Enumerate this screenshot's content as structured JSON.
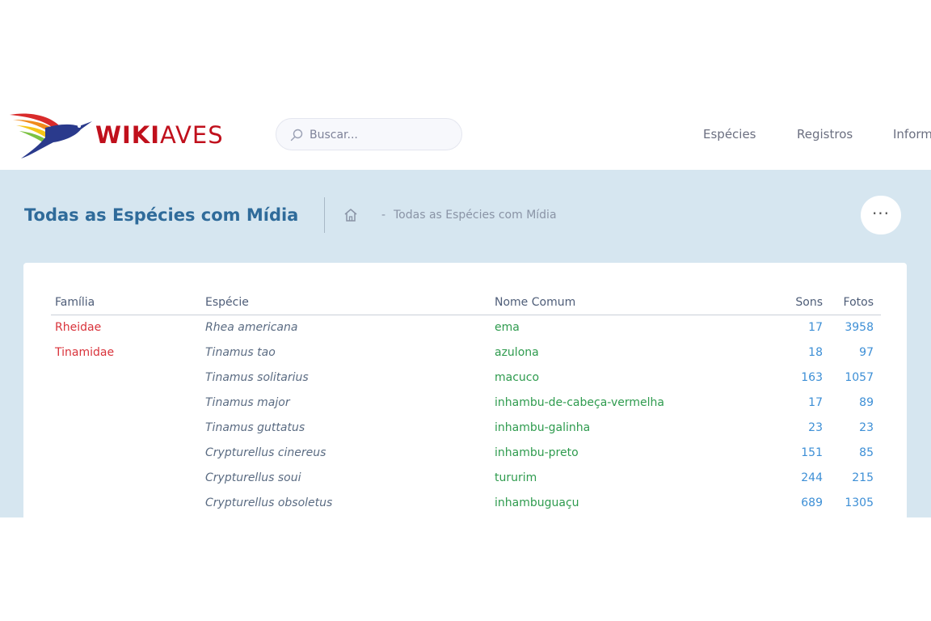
{
  "header": {
    "logo": {
      "text_bold": "WIKI",
      "text_light": "AVES"
    },
    "search": {
      "placeholder": "Buscar..."
    },
    "nav": [
      {
        "label": "Espécies"
      },
      {
        "label": "Registros"
      },
      {
        "label": "Informações"
      }
    ]
  },
  "subheader": {
    "title": "Todas as Espécies com Mídia",
    "breadcrumb": {
      "separator": "-",
      "current": "Todas as Espécies com Mídia"
    },
    "more_label": "···"
  },
  "table": {
    "columns": [
      "Família",
      "Espécie",
      "Nome Comum",
      "Sons",
      "Fotos"
    ],
    "rows": [
      {
        "familia": "Rheidae",
        "especie": "Rhea americana",
        "comum": "ema",
        "sons": "17",
        "fotos": "3958"
      },
      {
        "familia": "Tinamidae",
        "especie": "Tinamus tao",
        "comum": "azulona",
        "sons": "18",
        "fotos": "97"
      },
      {
        "familia": "",
        "especie": "Tinamus solitarius",
        "comum": "macuco",
        "sons": "163",
        "fotos": "1057"
      },
      {
        "familia": "",
        "especie": "Tinamus major",
        "comum": "inhambu-de-cabeça-vermelha",
        "sons": "17",
        "fotos": "89"
      },
      {
        "familia": "",
        "especie": "Tinamus guttatus",
        "comum": "inhambu-galinha",
        "sons": "23",
        "fotos": "23"
      },
      {
        "familia": "",
        "especie": "Crypturellus cinereus",
        "comum": "inhambu-preto",
        "sons": "151",
        "fotos": "85"
      },
      {
        "familia": "",
        "especie": "Crypturellus soui",
        "comum": "tururim",
        "sons": "244",
        "fotos": "215"
      },
      {
        "familia": "",
        "especie": "Crypturellus obsoletus",
        "comum": "inhambuguaçu",
        "sons": "689",
        "fotos": "1305"
      }
    ]
  },
  "colors": {
    "brand_red": "#c0101c",
    "title_blue": "#2f6b9a",
    "subbar_bg": "#d6e6f0",
    "family_red": "#d9333b",
    "common_green": "#2e9b4e",
    "count_blue": "#3d8fd6"
  },
  "icons": {
    "logo": "hummingbird-icon",
    "search": "search-icon",
    "home": "home-icon",
    "more": "more-horizontal-icon"
  }
}
